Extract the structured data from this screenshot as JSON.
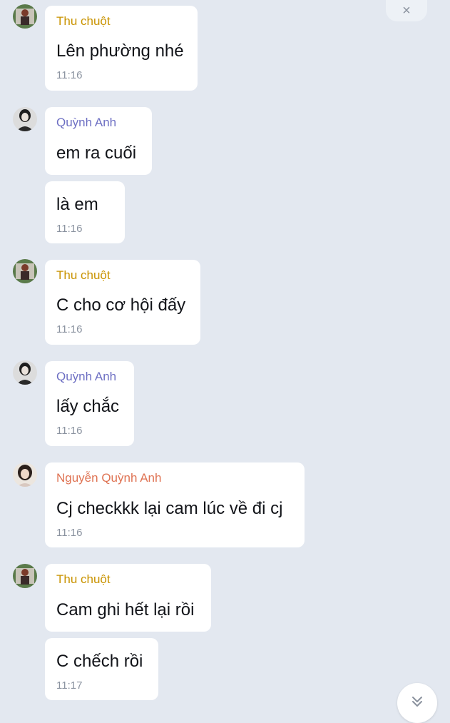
{
  "colors": {
    "background": "#e3e8f0",
    "bubble": "#ffffff",
    "thu_chuot": "#c99300",
    "quynh_anh": "#6d6fc3",
    "nguyen_quynh_anh": "#df7353",
    "time": "#8b93a0"
  },
  "header": {
    "close_label": "×"
  },
  "messages": [
    {
      "sender": "Thu chuột",
      "text": "Lên phường nhé",
      "time": "11:16"
    },
    {
      "sender": "Quỳnh Anh",
      "text": "em ra cuối",
      "time": ""
    },
    {
      "sender": "",
      "text": "là em",
      "time": "11:16"
    },
    {
      "sender": "Thu chuột",
      "text": "C cho cơ hội đấy",
      "time": "11:16"
    },
    {
      "sender": "Quỳnh Anh",
      "text": "lấy chắc",
      "time": "11:16"
    },
    {
      "sender": "Nguyễn Quỳnh Anh",
      "text": "Cj checkkk lại cam lúc về đi cj",
      "time": "11:16"
    },
    {
      "sender": "Thu chuột",
      "text": "Cam ghi hết lại rồi",
      "time": ""
    },
    {
      "sender": "",
      "text": "C chếch rồi",
      "time": "11:17"
    }
  ],
  "scroll": {
    "icon": "double-chevron-down-icon"
  }
}
